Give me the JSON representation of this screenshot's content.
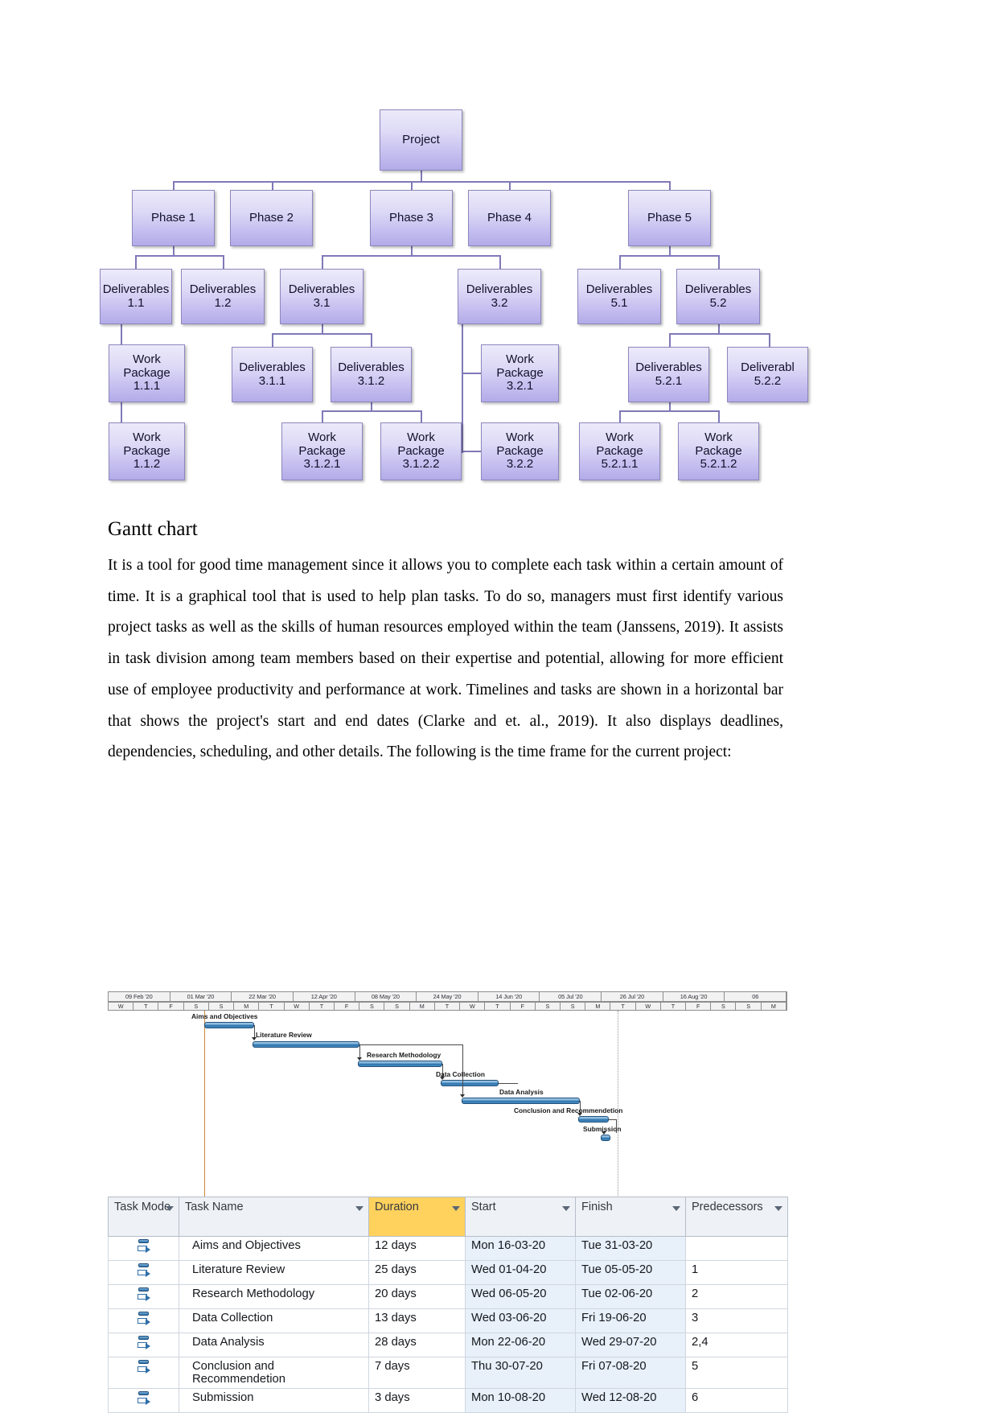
{
  "wbs": {
    "root": {
      "label": "Project"
    },
    "phases": [
      {
        "label": "Phase 1"
      },
      {
        "label": "Phase 2"
      },
      {
        "label": "Phase 3"
      },
      {
        "label": "Phase 4"
      },
      {
        "label": "Phase 5"
      }
    ],
    "deliverables_l2": [
      {
        "label": "Deliverables\n1.1"
      },
      {
        "label": "Deliverables\n1.2"
      },
      {
        "label": "Deliverables\n3.1"
      },
      {
        "label": "Deliverables\n3.2"
      },
      {
        "label": "Deliverables\n5.1"
      },
      {
        "label": "Deliverables\n5.2"
      }
    ],
    "level3": [
      {
        "label": "Work\nPackage\n1.1.1"
      },
      {
        "label": "Deliverables\n3.1.1"
      },
      {
        "label": "Deliverables\n3.1.2"
      },
      {
        "label": "Work\nPackage\n3.2.1"
      },
      {
        "label": "Deliverables\n5.2.1"
      },
      {
        "label": "Deliverabl\n5.2.2"
      }
    ],
    "level4": [
      {
        "label": "Work\nPackage\n1.1.2"
      },
      {
        "label": "Work\nPackage\n3.1.2.1"
      },
      {
        "label": "Work\nPackage\n3.1.2.2"
      },
      {
        "label": "Work\nPackage\n3.2.2"
      },
      {
        "label": "Work\nPackage\n5.2.1.1"
      },
      {
        "label": "Work\nPackage\n5.2.1.2"
      }
    ]
  },
  "document": {
    "heading": "Gantt chart",
    "paragraph": "It is a tool for good time management since it allows you to complete each task within a certain amount of time. It is a graphical tool that is used to help plan tasks. To do so, managers must first identify various project tasks as well as the skills of human resources employed within the team (Janssens, 2019). It assists in task division among team members based on their expertise and potential, allowing for more efficient use of employee productivity and performance at work. Timelines and tasks are shown in a horizontal bar that shows the project's start and end dates (Clarke and et. al., 2019). It also displays deadlines, dependencies, scheduling, and other details. The following is the time frame for the current project:"
  },
  "chart_data": {
    "type": "gantt",
    "title": "Project Gantt chart",
    "timeline_weeks": [
      "09 Feb '20",
      "01 Mar '20",
      "22 Mar '20",
      "12 Apr '20",
      "08 May '20",
      "24 May '20",
      "14 Jun '20",
      "05 Jul '20",
      "26 Jul '20",
      "16 Aug '20",
      "06"
    ],
    "timeline_days": [
      "W",
      "T",
      "F",
      "S",
      "S",
      "M",
      "T",
      "W",
      "T",
      "F",
      "S",
      "S",
      "M",
      "T",
      "W",
      "T",
      "F",
      "S",
      "S",
      "M",
      "T",
      "W",
      "T",
      "F",
      "S",
      "S",
      "M"
    ],
    "columns": [
      "Task Mode",
      "Task Name",
      "Duration",
      "Start",
      "Finish",
      "Predecessors"
    ],
    "tasks": [
      {
        "id": 1,
        "name": "Aims and Objectives",
        "duration": "12 days",
        "start": "Mon 16-03-20",
        "finish": "Tue 31-03-20",
        "predecessors": ""
      },
      {
        "id": 2,
        "name": "Literature Review",
        "duration": "25 days",
        "start": "Wed 01-04-20",
        "finish": "Tue 05-05-20",
        "predecessors": "1"
      },
      {
        "id": 3,
        "name": "Research Methodology",
        "duration": "20 days",
        "start": "Wed 06-05-20",
        "finish": "Tue 02-06-20",
        "predecessors": "2"
      },
      {
        "id": 4,
        "name": "Data Collection",
        "duration": "13 days",
        "start": "Wed 03-06-20",
        "finish": "Fri 19-06-20",
        "predecessors": "3"
      },
      {
        "id": 5,
        "name": "Data Analysis",
        "duration": "28 days",
        "start": "Mon 22-06-20",
        "finish": "Wed 29-07-20",
        "predecessors": "2,4"
      },
      {
        "id": 6,
        "name": "Conclusion and Recommendetion",
        "duration": "7 days",
        "start": "Thu 30-07-20",
        "finish": "Fri 07-08-20",
        "predecessors": "5"
      },
      {
        "id": 7,
        "name": "Submission",
        "duration": "3 days",
        "start": "Mon 10-08-20",
        "finish": "Wed 12-08-20",
        "predecessors": "6"
      }
    ],
    "bar_color": "#2e75b6",
    "duration_header_color": "#ffd25e"
  }
}
